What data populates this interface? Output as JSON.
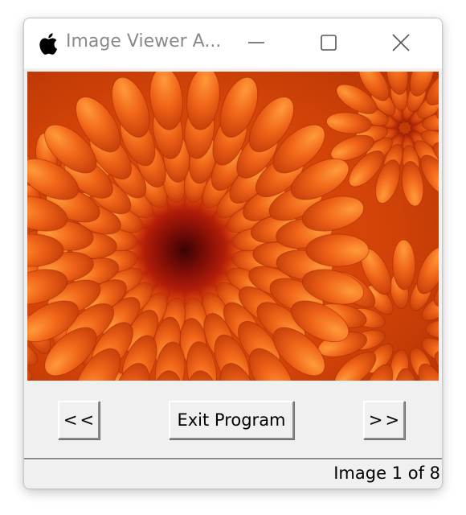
{
  "window": {
    "title": "Image Viewer A...",
    "app_icon": "apple-logo-icon",
    "controls": {
      "minimize_icon": "minimize-icon",
      "maximize_icon": "maximize-icon",
      "close_icon": "close-icon"
    }
  },
  "viewer": {
    "image_icon": "orange-chrysanthemum-photo",
    "colors": {
      "petal_dark": "#c93a0a",
      "petal_mid": "#e85a14",
      "petal_light": "#ff8a2a",
      "center": "#8a1208"
    }
  },
  "controls": {
    "prev_label": "<<",
    "exit_label": "Exit Program",
    "next_label": ">>"
  },
  "status": {
    "text": "Image 1 of 8"
  }
}
